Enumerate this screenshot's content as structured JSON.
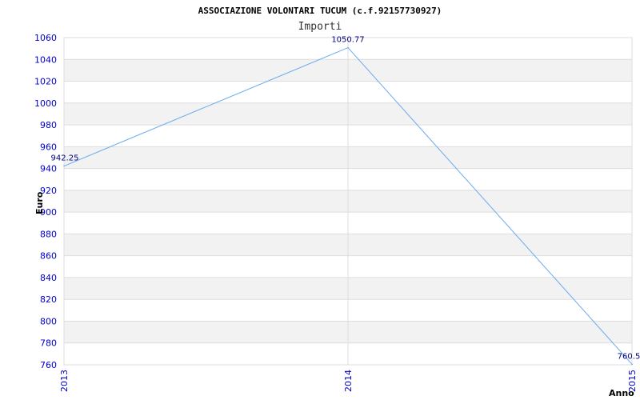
{
  "chart_data": {
    "type": "line",
    "title": "ASSOCIAZIONE VOLONTARI TUCUM (c.f.92157730927)",
    "subtitle": "Importi",
    "xlabel": "Anno",
    "ylabel": "Euro",
    "categories": [
      "2013",
      "2014",
      "2015"
    ],
    "series": [
      {
        "values": [
          942.25,
          1050.77,
          760.5
        ]
      }
    ],
    "data_labels": [
      "942.25",
      "1050.77",
      "760.5"
    ],
    "ylim": [
      760,
      1060
    ],
    "y_ticks": [
      "760",
      "780",
      "800",
      "820",
      "840",
      "860",
      "880",
      "900",
      "920",
      "940",
      "960",
      "980",
      "1000",
      "1020",
      "1040",
      "1060"
    ],
    "grid": true,
    "colors": {
      "line": "#6aaaf0",
      "band": "#f2f2f2",
      "grid": "#dddddd",
      "axis_text": "#0000cc",
      "label_text": "#000080"
    }
  }
}
